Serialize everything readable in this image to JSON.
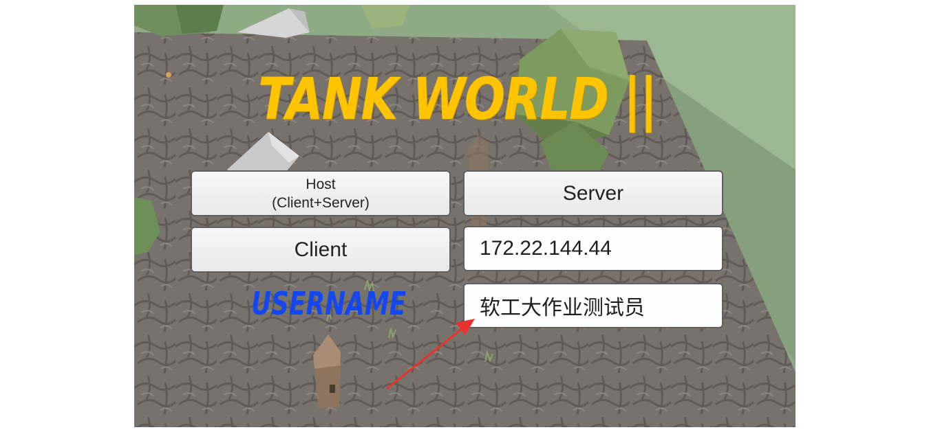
{
  "app": {
    "title": "TANK WORLD",
    "title_suffix": "||"
  },
  "buttons": {
    "host_line1": "Host",
    "host_line2": "(Client+Server)",
    "server": "Server",
    "client": "Client"
  },
  "fields": {
    "server_address_value": "172.22.144.44",
    "username_label": "USERNAME",
    "username_value": "软工大作业测试员"
  },
  "colors": {
    "title": "#ffc400",
    "username_label": "#1447f0",
    "annotation_arrow": "#e8322c"
  },
  "icons": {
    "annotation": "red-arrow-icon"
  }
}
